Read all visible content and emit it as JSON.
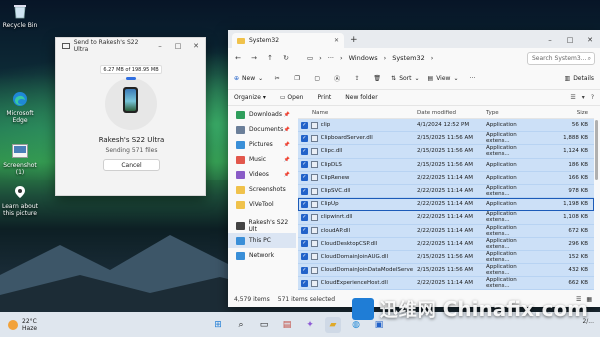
{
  "desktop": {
    "icons": [
      {
        "label": "Recycle Bin",
        "icon": "recycle-bin-icon"
      },
      {
        "label": "Microsoft Edge",
        "icon": "edge-icon"
      },
      {
        "label": "Screenshot (1)",
        "icon": "image-file-icon"
      },
      {
        "label": "Learn about this picture",
        "icon": "location-pin-icon"
      }
    ]
  },
  "transfer_dialog": {
    "title": "Send to Rakesh's S22 Ultra",
    "progress_text": "6.27 MB of 198.95 MB",
    "progress_fraction": 0.032,
    "device_name": "Rakesh's S22 Ultra",
    "status": "Sending 571 files",
    "cancel_label": "Cancel"
  },
  "explorer": {
    "tab_title": "System32",
    "address": [
      "Windows",
      "System32"
    ],
    "search_placeholder": "Search System3...",
    "toolbar": {
      "new_label": "New",
      "sort_label": "Sort",
      "view_label": "View",
      "details_label": "Details"
    },
    "subbar": {
      "organize_label": "Organize",
      "open_label": "Open",
      "print_label": "Print",
      "newfolder_label": "New folder"
    },
    "nav": [
      {
        "label": "Downloads",
        "color": "#2f9e5c"
      },
      {
        "label": "Documents",
        "color": "#6b7f99"
      },
      {
        "label": "Pictures",
        "color": "#3a8fd8"
      },
      {
        "label": "Music",
        "color": "#e2574c"
      },
      {
        "label": "Videos",
        "color": "#8a5cc7"
      },
      {
        "label": "Screenshots",
        "color": "#f0c24b"
      },
      {
        "label": "ViVeTool",
        "color": "#f0c24b"
      },
      {
        "label": "Rakesh's S22 Ult",
        "color": "#444444"
      },
      {
        "label": "This PC",
        "color": "#3a8fd8"
      },
      {
        "label": "Network",
        "color": "#3a8fd8"
      }
    ],
    "columns": {
      "name": "Name",
      "date": "Date modified",
      "type": "Type",
      "size": "Size"
    },
    "rows": [
      {
        "name": "clip",
        "date": "4/1/2024 12:52 PM",
        "type": "Application",
        "size": "56 KB"
      },
      {
        "name": "ClipboardServer.dll",
        "date": "2/15/2025 11:56 AM",
        "type": "Application extens...",
        "size": "1,888 KB"
      },
      {
        "name": "Clipc.dll",
        "date": "2/15/2025 11:56 AM",
        "type": "Application extens...",
        "size": "1,124 KB"
      },
      {
        "name": "ClipDLS",
        "date": "2/15/2025 11:56 AM",
        "type": "Application",
        "size": "186 KB"
      },
      {
        "name": "ClipRenew",
        "date": "2/22/2025 11:14 AM",
        "type": "Application",
        "size": "166 KB"
      },
      {
        "name": "ClipSVC.dll",
        "date": "2/22/2025 11:14 AM",
        "type": "Application extens...",
        "size": "978 KB"
      },
      {
        "name": "ClipUp",
        "date": "2/22/2025 11:14 AM",
        "type": "Application",
        "size": "1,198 KB"
      },
      {
        "name": "clipwinrt.dll",
        "date": "2/22/2025 11:14 AM",
        "type": "Application extens...",
        "size": "1,108 KB"
      },
      {
        "name": "cloudAP.dll",
        "date": "2/22/2025 11:14 AM",
        "type": "Application extens...",
        "size": "672 KB"
      },
      {
        "name": "CloudDesktopCSP.dll",
        "date": "2/22/2025 11:14 AM",
        "type": "Application extens...",
        "size": "296 KB"
      },
      {
        "name": "CloudDomainJoinAUG.dll",
        "date": "2/15/2025 11:56 AM",
        "type": "Application extens...",
        "size": "152 KB"
      },
      {
        "name": "CloudDomainJoinDataModelServer.dll",
        "date": "2/15/2025 11:56 AM",
        "type": "Application extens...",
        "size": "432 KB"
      },
      {
        "name": "CloudExperienceHost.dll",
        "date": "2/22/2025 11:14 AM",
        "type": "Application extens...",
        "size": "662 KB"
      }
    ],
    "status_count": "4,579 items",
    "status_selected": "571 items selected"
  },
  "taskbar": {
    "weather_temp": "22°C",
    "weather_desc": "Haze",
    "tray_date": "2/..."
  },
  "watermark": {
    "cn": "迅维网",
    "en": "Chinafix.com"
  }
}
